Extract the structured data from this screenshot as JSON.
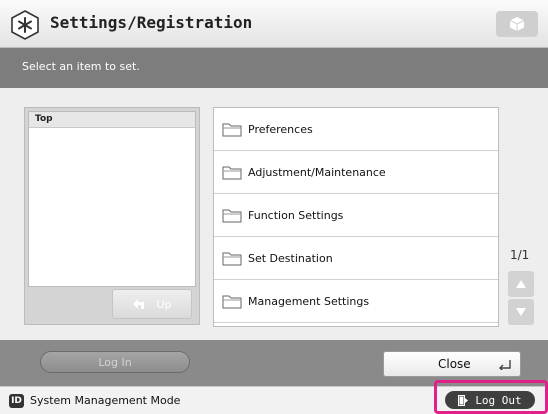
{
  "header": {
    "title": "Settings/Registration",
    "title_icon": "settings-registration-icon",
    "corner_icon": "cube-icon"
  },
  "instruction": "Select an item to set.",
  "tree": {
    "header": "Top",
    "up_label": "Up"
  },
  "menu": {
    "items": [
      {
        "label": "Preferences",
        "icon": "folder-icon"
      },
      {
        "label": "Adjustment/Maintenance",
        "icon": "folder-icon"
      },
      {
        "label": "Function Settings",
        "icon": "folder-icon"
      },
      {
        "label": "Set Destination",
        "icon": "folder-icon"
      },
      {
        "label": "Management Settings",
        "icon": "folder-icon"
      }
    ]
  },
  "pager": {
    "indicator": "1/1"
  },
  "actions": {
    "login_label": "Log In",
    "close_label": "Close"
  },
  "status": {
    "id_badge": "ID",
    "mode": "System Management Mode",
    "logout_label": "Log Out"
  },
  "colors": {
    "highlight": "#e0218a",
    "instruction_bar": "#7d7d7d",
    "action_bar": "#8a8a8a"
  }
}
